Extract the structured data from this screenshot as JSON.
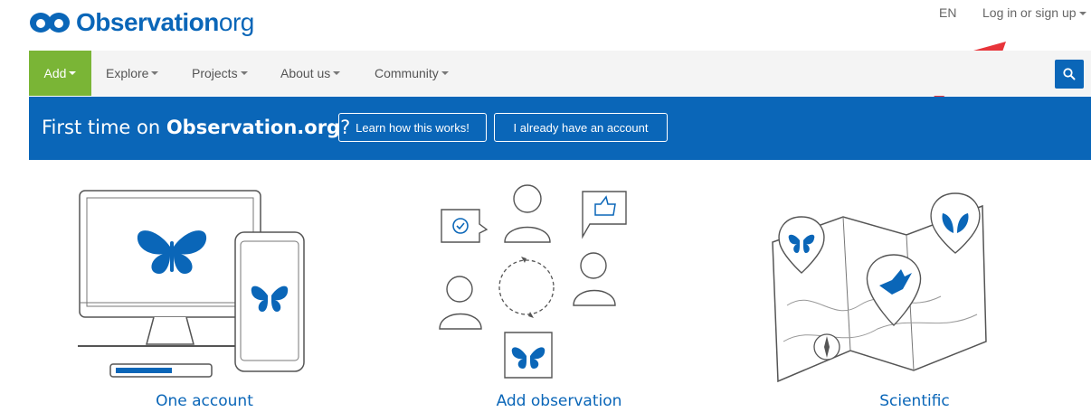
{
  "header": {
    "logo_main": "Observation",
    "logo_suffix": "org",
    "language": "EN",
    "login_label": "Log in or sign up"
  },
  "nav": {
    "items": [
      {
        "label": "Add"
      },
      {
        "label": "Explore"
      },
      {
        "label": "Projects"
      },
      {
        "label": "About us"
      },
      {
        "label": "Community"
      }
    ]
  },
  "banner": {
    "prefix": "First time on ",
    "site": "Observation.org",
    "suffix": "?",
    "learn_button": "Learn how this works!",
    "account_button": "I already have an account"
  },
  "features": [
    {
      "caption": "One account",
      "icon": "devices-butterfly-icon"
    },
    {
      "caption": "Add observation",
      "icon": "community-cycle-icon"
    },
    {
      "caption": "Scientific",
      "icon": "map-pins-icon"
    }
  ],
  "colors": {
    "brand_blue": "#0a66b8",
    "add_green": "#7ab536",
    "nav_bg": "#f4f4f4",
    "annotation_arrow": "#e8343a"
  }
}
